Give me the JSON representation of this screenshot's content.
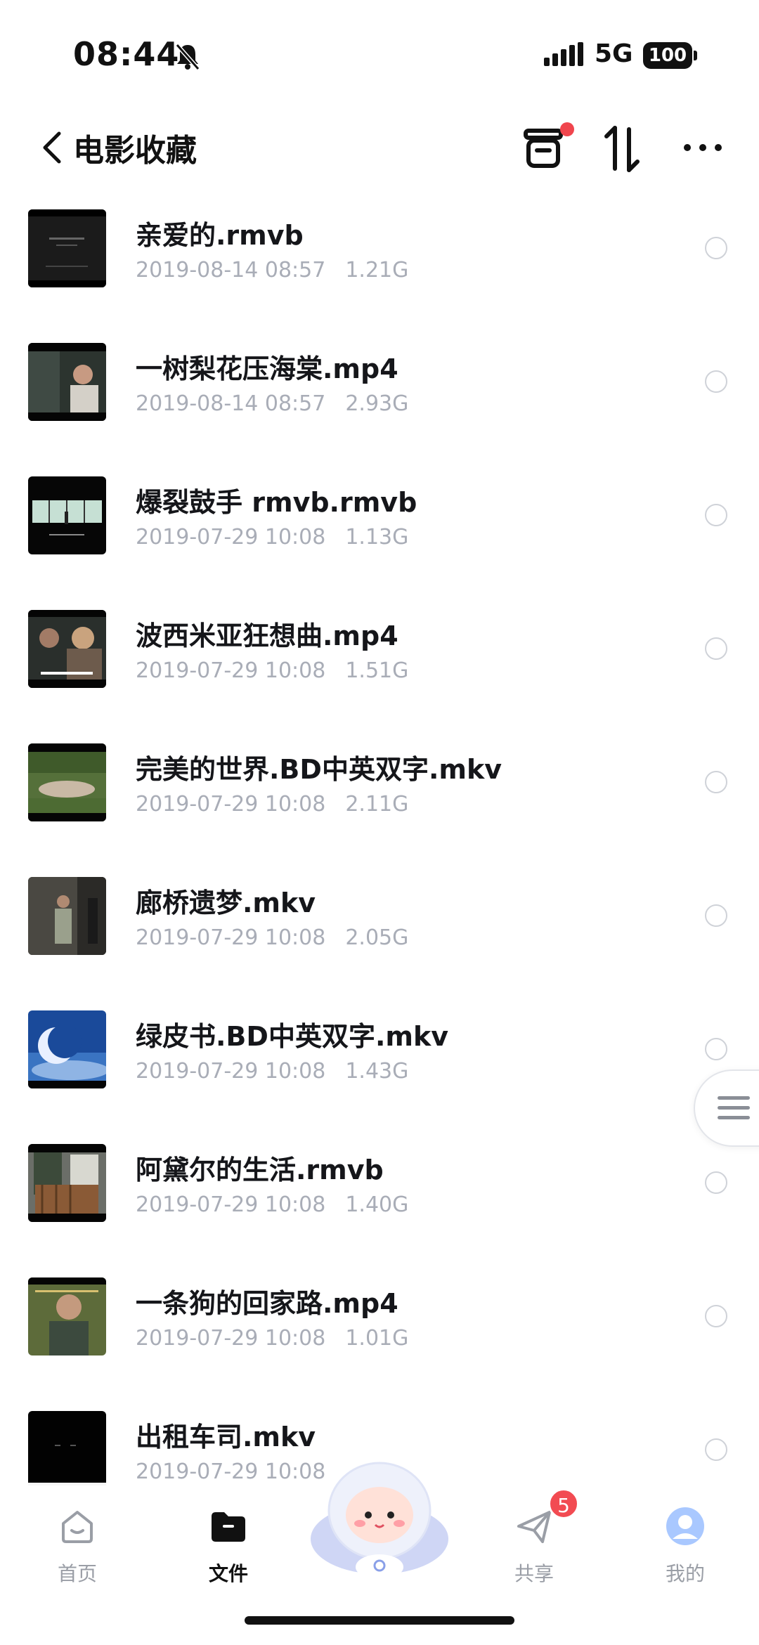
{
  "status_bar": {
    "time": "08:44",
    "network": "5G",
    "battery": "100"
  },
  "header": {
    "title": "电影收藏"
  },
  "files": [
    {
      "name": "亲爱的.rmvb",
      "date": "2019-08-14 08:57",
      "size": "1.21G",
      "thumb": "dark-title"
    },
    {
      "name": "一树梨花压海棠.mp4",
      "date": "2019-08-14 08:57",
      "size": "2.93G",
      "thumb": "car-scene"
    },
    {
      "name": "爆裂鼓手 rmvb.rmvb",
      "date": "2019-07-29 10:08",
      "size": "1.13G",
      "thumb": "corridor-scene"
    },
    {
      "name": "波西米亚狂想曲.mp4",
      "date": "2019-07-29 10:08",
      "size": "1.51G",
      "thumb": "portrait-scene"
    },
    {
      "name": "完美的世界.BD中英双字.mkv",
      "date": "2019-07-29 10:08",
      "size": "2.11G",
      "thumb": "grass-scene"
    },
    {
      "name": "廊桥遗梦.mkv",
      "date": "2019-07-29 10:08",
      "size": "2.05G",
      "thumb": "street-scene"
    },
    {
      "name": "绿皮书.BD中英双字.mkv",
      "date": "2019-07-29 10:08",
      "size": "1.43G",
      "thumb": "moon-scene"
    },
    {
      "name": "阿黛尔的生活.rmvb",
      "date": "2019-07-29 10:08",
      "size": "1.40G",
      "thumb": "door-scene"
    },
    {
      "name": "一条狗的回家路.mp4",
      "date": "2019-07-29 10:08",
      "size": "1.01G",
      "thumb": "man-scene"
    },
    {
      "name": "出租车司.mkv",
      "date": "2019-07-29 10:08",
      "size": "",
      "thumb": "black-scene"
    }
  ],
  "bottom_nav": {
    "home": "首页",
    "files": "文件",
    "share": "共享",
    "share_badge": "5",
    "me": "我的"
  },
  "colors": {
    "accent": "#1a1a1a",
    "badge": "#f24b52",
    "meta": "#a9adb7"
  }
}
